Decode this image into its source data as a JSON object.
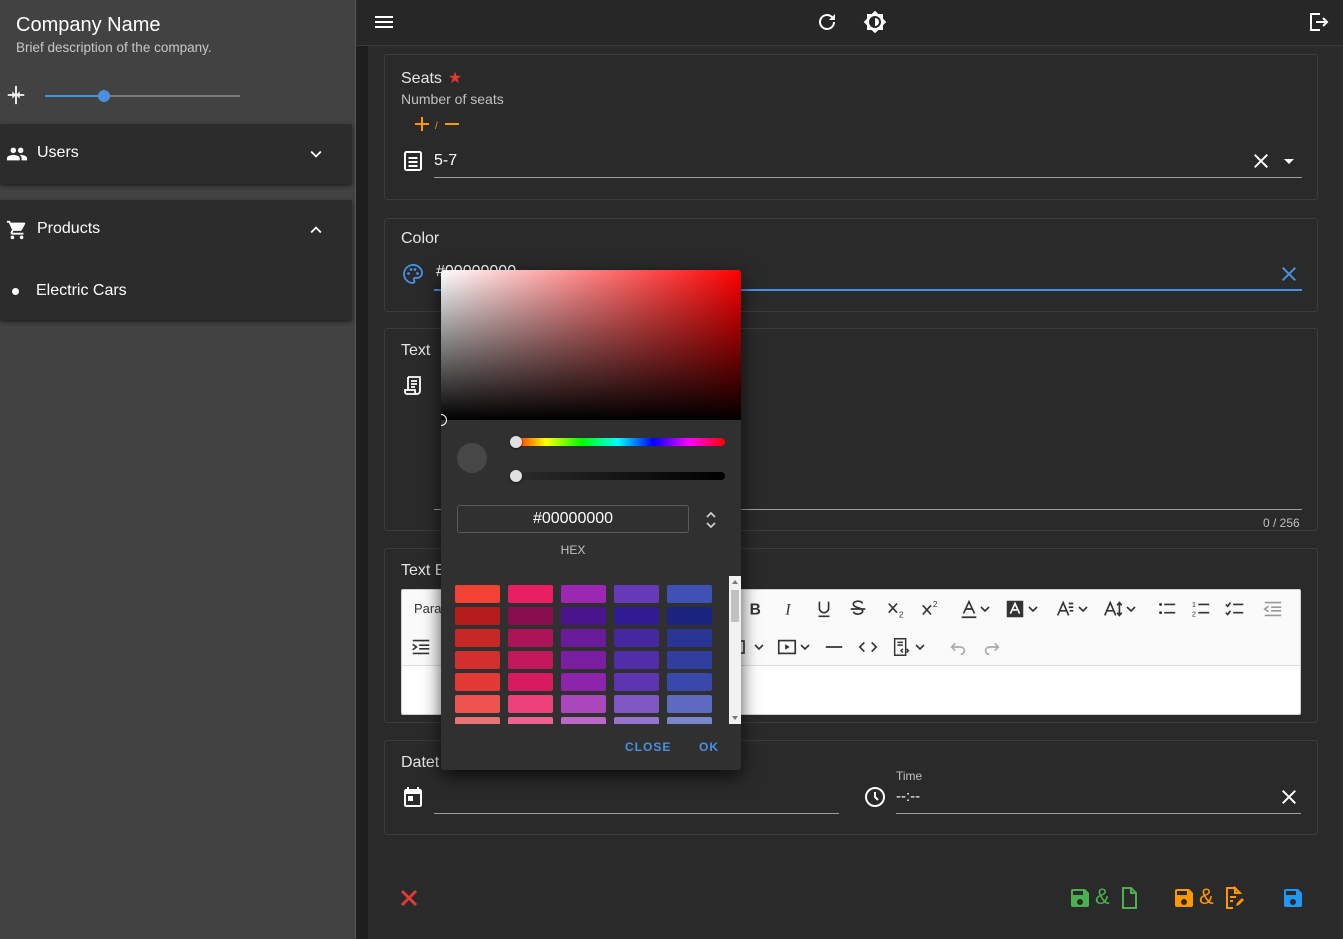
{
  "sidebar": {
    "company_name": "Company Name",
    "company_description": "Brief description of the company.",
    "width_slider_value": 0.3,
    "menu": [
      {
        "label": "Users",
        "icon": "users-icon",
        "expanded": false
      },
      {
        "label": "Products",
        "icon": "cart-icon",
        "expanded": true,
        "items": [
          {
            "label": "Electric Cars"
          }
        ]
      }
    ]
  },
  "topbar": {
    "icons": [
      "menu-icon",
      "refresh-icon",
      "theme-toggle-icon",
      "logout-icon"
    ]
  },
  "form": {
    "seats": {
      "label": "Seats",
      "required_mark": "★",
      "helper": "Number of seats",
      "plus_minus_slash": "/",
      "value": "5-7"
    },
    "color": {
      "label": "Color",
      "value": "#00000000"
    },
    "text": {
      "label": "Text",
      "counter": "0 / 256"
    },
    "text_editor": {
      "label": "Text E",
      "paragraph_label": "Para"
    },
    "datetime": {
      "label": "Datet",
      "time_label": "Time",
      "time_value": "--:--"
    }
  },
  "color_picker": {
    "hex_value": "#00000000",
    "hex_mode_label": "HEX",
    "hue": 0,
    "alpha": 0,
    "close_label": "CLOSE",
    "ok_label": "OK",
    "swatches": [
      [
        "#f44336",
        "#e91e63",
        "#9c27b0",
        "#673ab7",
        "#3f51b5"
      ],
      [
        "#b71c1c",
        "#880e4f",
        "#4a148c",
        "#311b92",
        "#1a237e"
      ],
      [
        "#c62828",
        "#ad1457",
        "#6a1b9a",
        "#4527a0",
        "#283593"
      ],
      [
        "#d32f2f",
        "#c2185b",
        "#7b1fa2",
        "#512da8",
        "#303f9f"
      ],
      [
        "#e53935",
        "#d81b60",
        "#8e24aa",
        "#5e35b1",
        "#3949ab"
      ],
      [
        "#ef5350",
        "#ec407a",
        "#ab47bc",
        "#7e57c2",
        "#5c6bc0"
      ],
      [
        "#e57373",
        "#f06292",
        "#ba68c8",
        "#9575cd",
        "#7986cb"
      ]
    ]
  },
  "actions": {
    "amp": "&",
    "colors": {
      "cancel": "#e53935",
      "save_new": "#4caf50",
      "save_edit": "#ff9800",
      "save": "#2196f3"
    }
  }
}
